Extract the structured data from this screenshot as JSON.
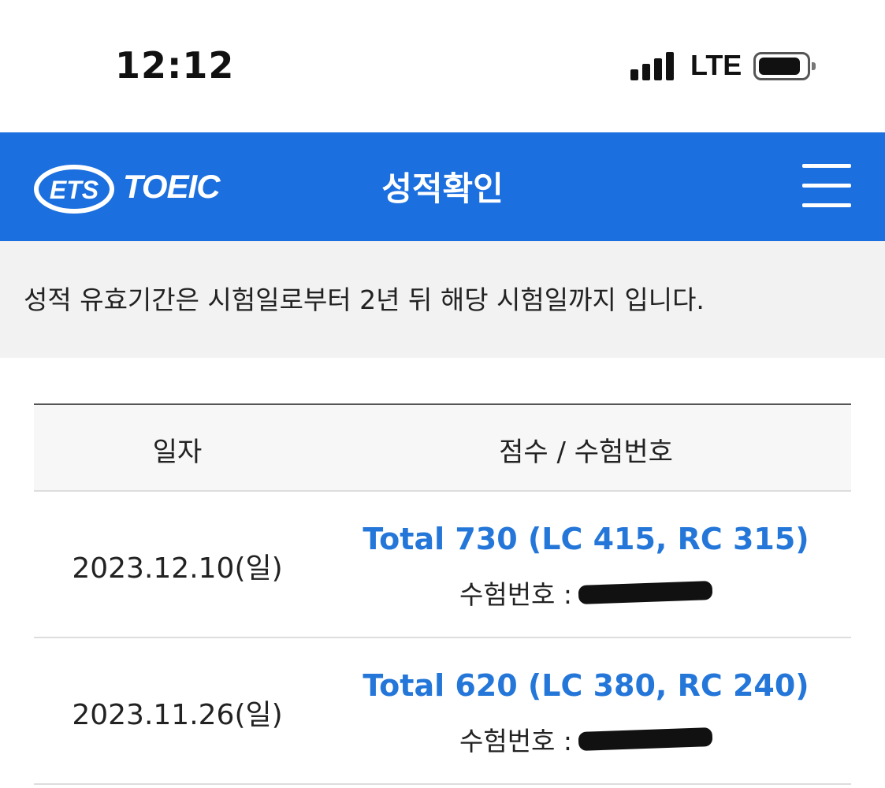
{
  "status_bar": {
    "time": "12:12",
    "network": "LTE",
    "icons": [
      "signal-icon",
      "battery-icon"
    ]
  },
  "header": {
    "logo_ets": "ETS",
    "logo_toeic": "TOEIC",
    "title": "성적확인",
    "menu_icon": "hamburger-menu-icon",
    "background_color": "#1b6fde"
  },
  "notice": {
    "text": "성적 유효기간은 시험일로부터 2년 뒤 해당 시험일까지 입니다."
  },
  "table": {
    "columns": [
      "일자",
      "점수 / 수험번호"
    ],
    "rows": [
      {
        "date": "2023.12.10(일)",
        "score": "Total 730 (LC 415, RC 315)",
        "exam_label": "수험번호 :",
        "exam_number": ""
      },
      {
        "date": "2023.11.26(일)",
        "score": "Total 620 (LC 380, RC 240)",
        "exam_label": "수험번호 :",
        "exam_number": ""
      }
    ]
  },
  "colors": {
    "accent": "#1b6fde",
    "score_text": "#2477d9",
    "notice_background": "#f2f2f2"
  }
}
